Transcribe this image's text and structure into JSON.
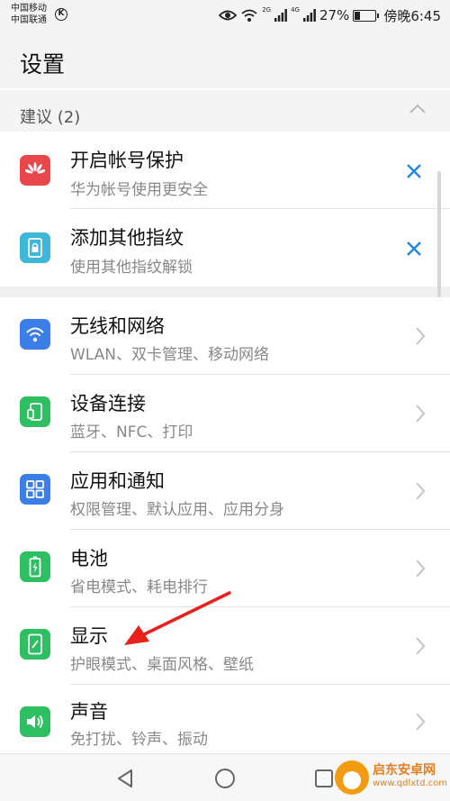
{
  "status_bar": {
    "carrier_1": "中国移动",
    "carrier_2": "中国联通",
    "k_badge": "K",
    "net_2g": "2G",
    "net_4g": "4G",
    "battery_percent": "27%",
    "battery_level": 0.27,
    "time": "傍晚6:45"
  },
  "header": {
    "title": "设置"
  },
  "suggestions": {
    "title": "建议 (2)",
    "items": [
      {
        "title": "开启帐号保护",
        "subtitle": "华为帐号使用更安全",
        "icon": "huawei-logo-icon",
        "color": "#e8484b"
      },
      {
        "title": "添加其他指纹",
        "subtitle": "使用其他指纹解锁",
        "icon": "fingerprint-lock-icon",
        "color": "#3fb7d9"
      }
    ]
  },
  "settings": [
    {
      "title": "无线和网络",
      "subtitle": "WLAN、双卡管理、移动网络",
      "icon": "wifi-icon",
      "color": "#3c7ee8"
    },
    {
      "title": "设备连接",
      "subtitle": "蓝牙、NFC、打印",
      "icon": "device-connection-icon",
      "color": "#2fbf63"
    },
    {
      "title": "应用和通知",
      "subtitle": "权限管理、默认应用、应用分身",
      "icon": "apps-grid-icon",
      "color": "#3c7ee8"
    },
    {
      "title": "电池",
      "subtitle": "省电模式、耗电排行",
      "icon": "battery-icon",
      "color": "#2fbf63"
    },
    {
      "title": "显示",
      "subtitle": "护眼模式、桌面风格、壁纸",
      "icon": "display-icon",
      "color": "#2fbf63"
    },
    {
      "title": "声音",
      "subtitle": "免打扰、铃声、振动",
      "icon": "speaker-icon",
      "color": "#2fbf63"
    }
  ],
  "watermark": {
    "name": "启东安卓网",
    "url": "www.qdlxtd.com"
  }
}
